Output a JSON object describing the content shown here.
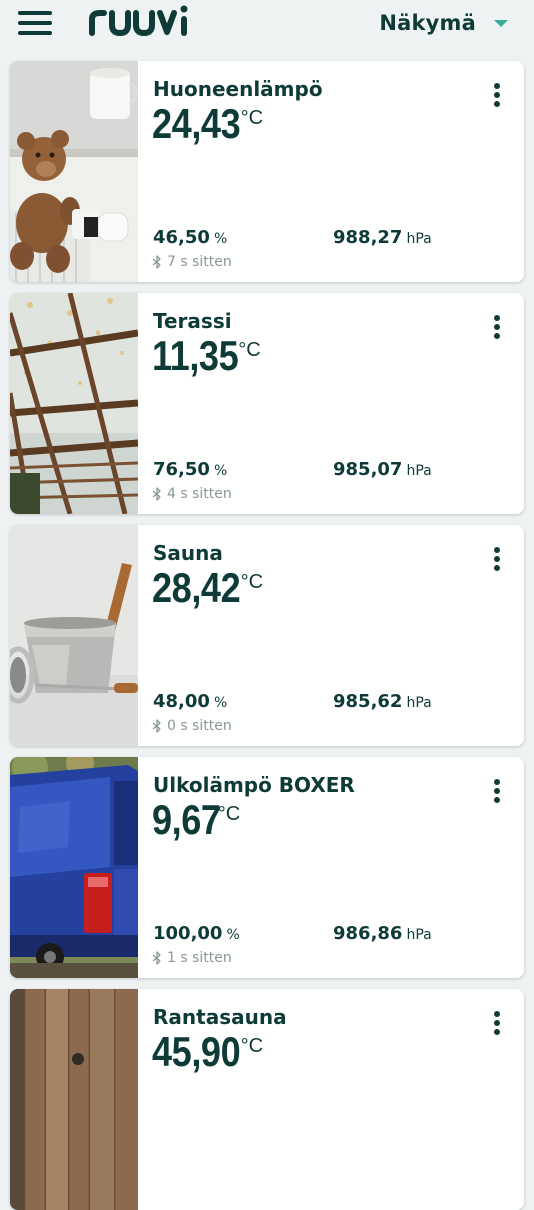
{
  "header": {
    "logo_text": "ruuvi",
    "view_label": "Näkymä",
    "brand_color": "#0e3b37",
    "accent_color": "#35ad9f"
  },
  "sensors": [
    {
      "name": "Huoneenlämpö",
      "temperature": "24,43",
      "temp_unit": "°C",
      "humidity": "46,50",
      "humidity_unit": "%",
      "pressure": "988,27",
      "pressure_unit": "hPa",
      "updated": "7 s sitten",
      "image": "teddy-bear-radiator"
    },
    {
      "name": "Terassi",
      "temperature": "11,35",
      "temp_unit": "°C",
      "humidity": "76,50",
      "humidity_unit": "%",
      "pressure": "985,07",
      "pressure_unit": "hPa",
      "updated": "4 s sitten",
      "image": "terrace-roof"
    },
    {
      "name": "Sauna",
      "temperature": "28,42",
      "temp_unit": "°C",
      "humidity": "48,00",
      "humidity_unit": "%",
      "pressure": "985,62",
      "pressure_unit": "hPa",
      "updated": "0 s sitten",
      "image": "sauna-bucket"
    },
    {
      "name": "Ulkolämpö BOXER",
      "temperature": "9,67",
      "temp_unit": "°C",
      "humidity": "100,00",
      "humidity_unit": "%",
      "pressure": "986,86",
      "pressure_unit": "hPa",
      "updated": "1 s sitten",
      "image": "blue-van"
    },
    {
      "name": "Rantasauna",
      "temperature": "45,90",
      "temp_unit": "°C",
      "image": "wooden-wall"
    }
  ]
}
